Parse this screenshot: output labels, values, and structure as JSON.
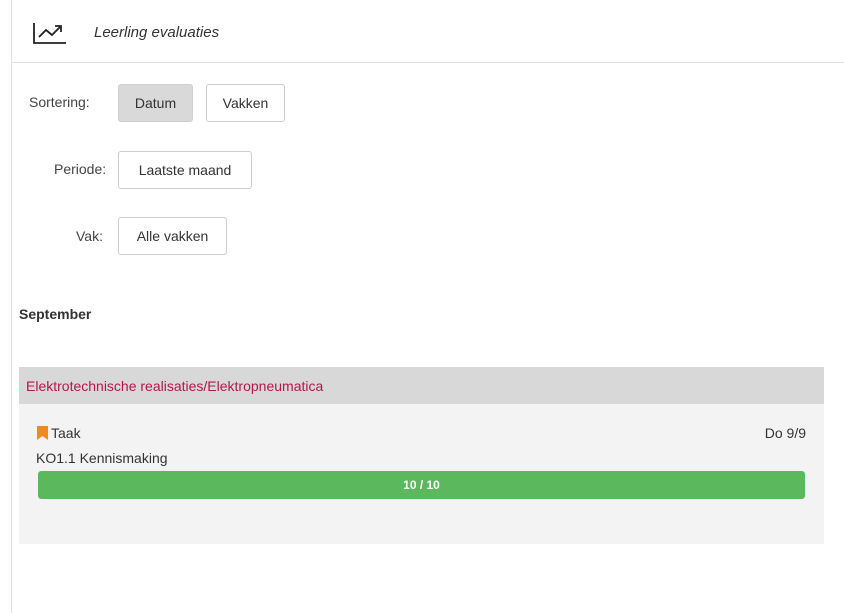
{
  "header": {
    "icon": "trending-up-chart-icon",
    "title": "Leerling evaluaties"
  },
  "filters": {
    "sort": {
      "label": "Sortering:",
      "options": [
        {
          "label": "Datum",
          "active": true
        },
        {
          "label": "Vakken",
          "active": false
        }
      ]
    },
    "period": {
      "label": "Periode:",
      "value": "Laatste maand"
    },
    "subject": {
      "label": "Vak:",
      "value": "Alle vakken"
    }
  },
  "months": [
    {
      "name": "September",
      "groups": [
        {
          "title": "Elektrotechnische realisaties/Elektropneumatica",
          "evaluations": [
            {
              "type_icon": "bookmark-icon",
              "type": "Taak",
              "date": "Do 9/9",
              "title": "KO1.1 Kennismaking",
              "score": 10,
              "max": 10,
              "score_text": "10 / 10"
            }
          ]
        }
      ]
    }
  ],
  "colors": {
    "accent_title": "#b3174b",
    "progress": "#5cb85c",
    "bookmark": "#f0891e",
    "active_button": "#d9d9d9",
    "group_header": "#d8d8d8",
    "group_body": "#f3f3f3"
  }
}
